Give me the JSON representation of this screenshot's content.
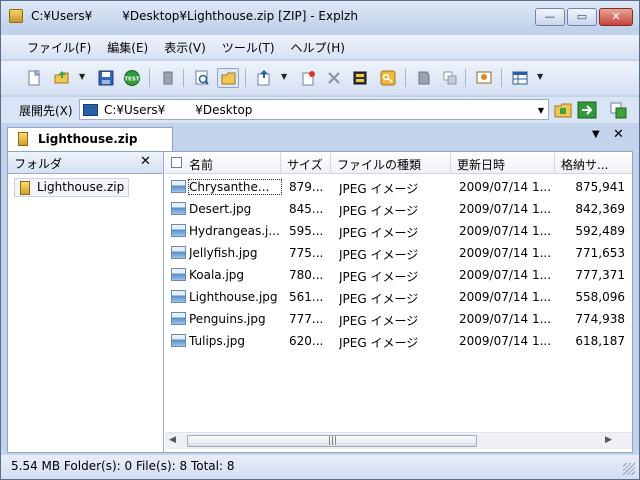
{
  "window": {
    "title": "C:¥Users¥     ¥Desktop¥Lighthouse.zip [ZIP] - Explzh",
    "buttons": {
      "minimize": "—",
      "maximize": "▭",
      "close": "✕"
    }
  },
  "menu": [
    "ファイル(F)",
    "編集(E)",
    "表示(V)",
    "ツール(T)",
    "ヘルプ(H)"
  ],
  "toolbar": {
    "icons": [
      "new-archive-icon",
      "open-icon",
      "save-icon",
      "test-icon",
      "extract-icon",
      "view-icon",
      "folder-view-icon",
      "add-icon",
      "add-files-icon",
      "delete-icon",
      "properties-icon",
      "key-icon",
      "edit-icon",
      "copy-icon",
      "comment-icon",
      "layout-icon"
    ],
    "test_badge": "TEST"
  },
  "address": {
    "label": "展開先(X)",
    "value": "C:¥Users¥     ¥Desktop"
  },
  "tab": {
    "label": "Lighthouse.zip",
    "menu_glyph": "▼",
    "close_glyph": "✕"
  },
  "folders": {
    "title": "フォルダ",
    "close_glyph": "✕",
    "items": [
      "Lighthouse.zip"
    ]
  },
  "list": {
    "columns": [
      "名前",
      "サイズ",
      "ファイルの種類",
      "更新日時",
      "格納サ..."
    ],
    "rows": [
      {
        "name": "Chrysanthe...",
        "size": "879...",
        "type": "JPEG イメージ",
        "date": "2009/07/14 1...",
        "stored": "875,941"
      },
      {
        "name": "Desert.jpg",
        "size": "845...",
        "type": "JPEG イメージ",
        "date": "2009/07/14 1...",
        "stored": "842,369"
      },
      {
        "name": "Hydrangeas.j...",
        "size": "595...",
        "type": "JPEG イメージ",
        "date": "2009/07/14 1...",
        "stored": "592,489"
      },
      {
        "name": "Jellyfish.jpg",
        "size": "775...",
        "type": "JPEG イメージ",
        "date": "2009/07/14 1...",
        "stored": "771,653"
      },
      {
        "name": "Koala.jpg",
        "size": "780...",
        "type": "JPEG イメージ",
        "date": "2009/07/14 1...",
        "stored": "777,371"
      },
      {
        "name": "Lighthouse.jpg",
        "size": "561...",
        "type": "JPEG イメージ",
        "date": "2009/07/14 1...",
        "stored": "558,096"
      },
      {
        "name": "Penguins.jpg",
        "size": "777...",
        "type": "JPEG イメージ",
        "date": "2009/07/14 1...",
        "stored": "774,938"
      },
      {
        "name": "Tulips.jpg",
        "size": "620...",
        "type": "JPEG イメージ",
        "date": "2009/07/14 1...",
        "stored": "618,187"
      }
    ]
  },
  "status": {
    "text": "5.54 MB  Folder(s): 0  File(s): 8  Total: 8"
  }
}
